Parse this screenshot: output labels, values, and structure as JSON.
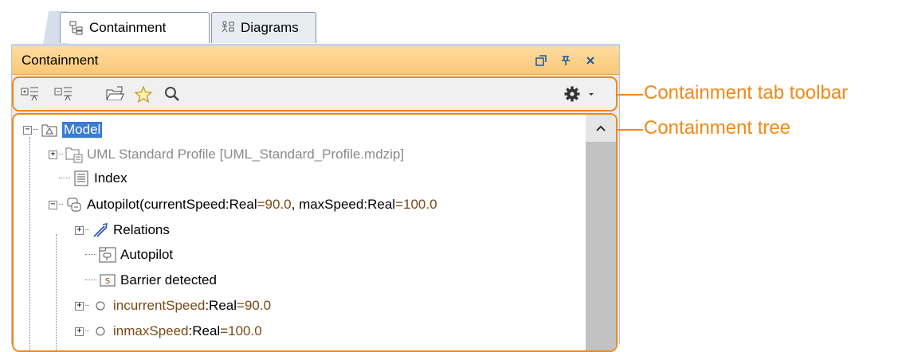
{
  "tabs": [
    {
      "label": "Containment",
      "icon": "containment-tree-icon",
      "active": true
    },
    {
      "label": "Diagrams",
      "icon": "diagrams-icon",
      "active": false
    }
  ],
  "panel": {
    "title": "Containment",
    "header_buttons": [
      "restore-icon",
      "pin-icon",
      "close-icon"
    ]
  },
  "toolbar": {
    "buttons": [
      "expand-all-icon",
      "collapse-all-icon",
      "open-folder-icon",
      "star-icon",
      "search-icon",
      "gear-icon",
      "dropdown-arrow-icon"
    ]
  },
  "tree": {
    "nodes": [
      {
        "label": "Model",
        "selected": true
      },
      {
        "label": "UML Standard Profile [UML_Standard_Profile.mdzip]"
      },
      {
        "label": "Index"
      },
      {
        "label": "Autopilot(",
        "params": [
          {
            "name": " currentSpeed",
            "sep": " : ",
            "type": "Real",
            "val": "=90.0"
          },
          {
            "name": ", maxSpeed",
            "sep": " : ",
            "type": "Real",
            "val": "=100.0"
          }
        ]
      },
      {
        "label": "Relations"
      },
      {
        "label": "Autopilot"
      },
      {
        "label": "Barrier detected"
      },
      {
        "dir": "in",
        "name": " currentSpeed",
        "sep": " : ",
        "type": "Real",
        "val": "=90.0"
      },
      {
        "dir": "in",
        "name": " maxSpeed",
        "sep": " : ",
        "type": "Real",
        "val": "=100.0"
      }
    ]
  },
  "annotations": {
    "toolbar": "Containment tab toolbar",
    "tree": "Containment tree"
  },
  "colors": {
    "callout": "#ef8a17",
    "header": "#f9c777",
    "selection": "#3a7bd5"
  }
}
